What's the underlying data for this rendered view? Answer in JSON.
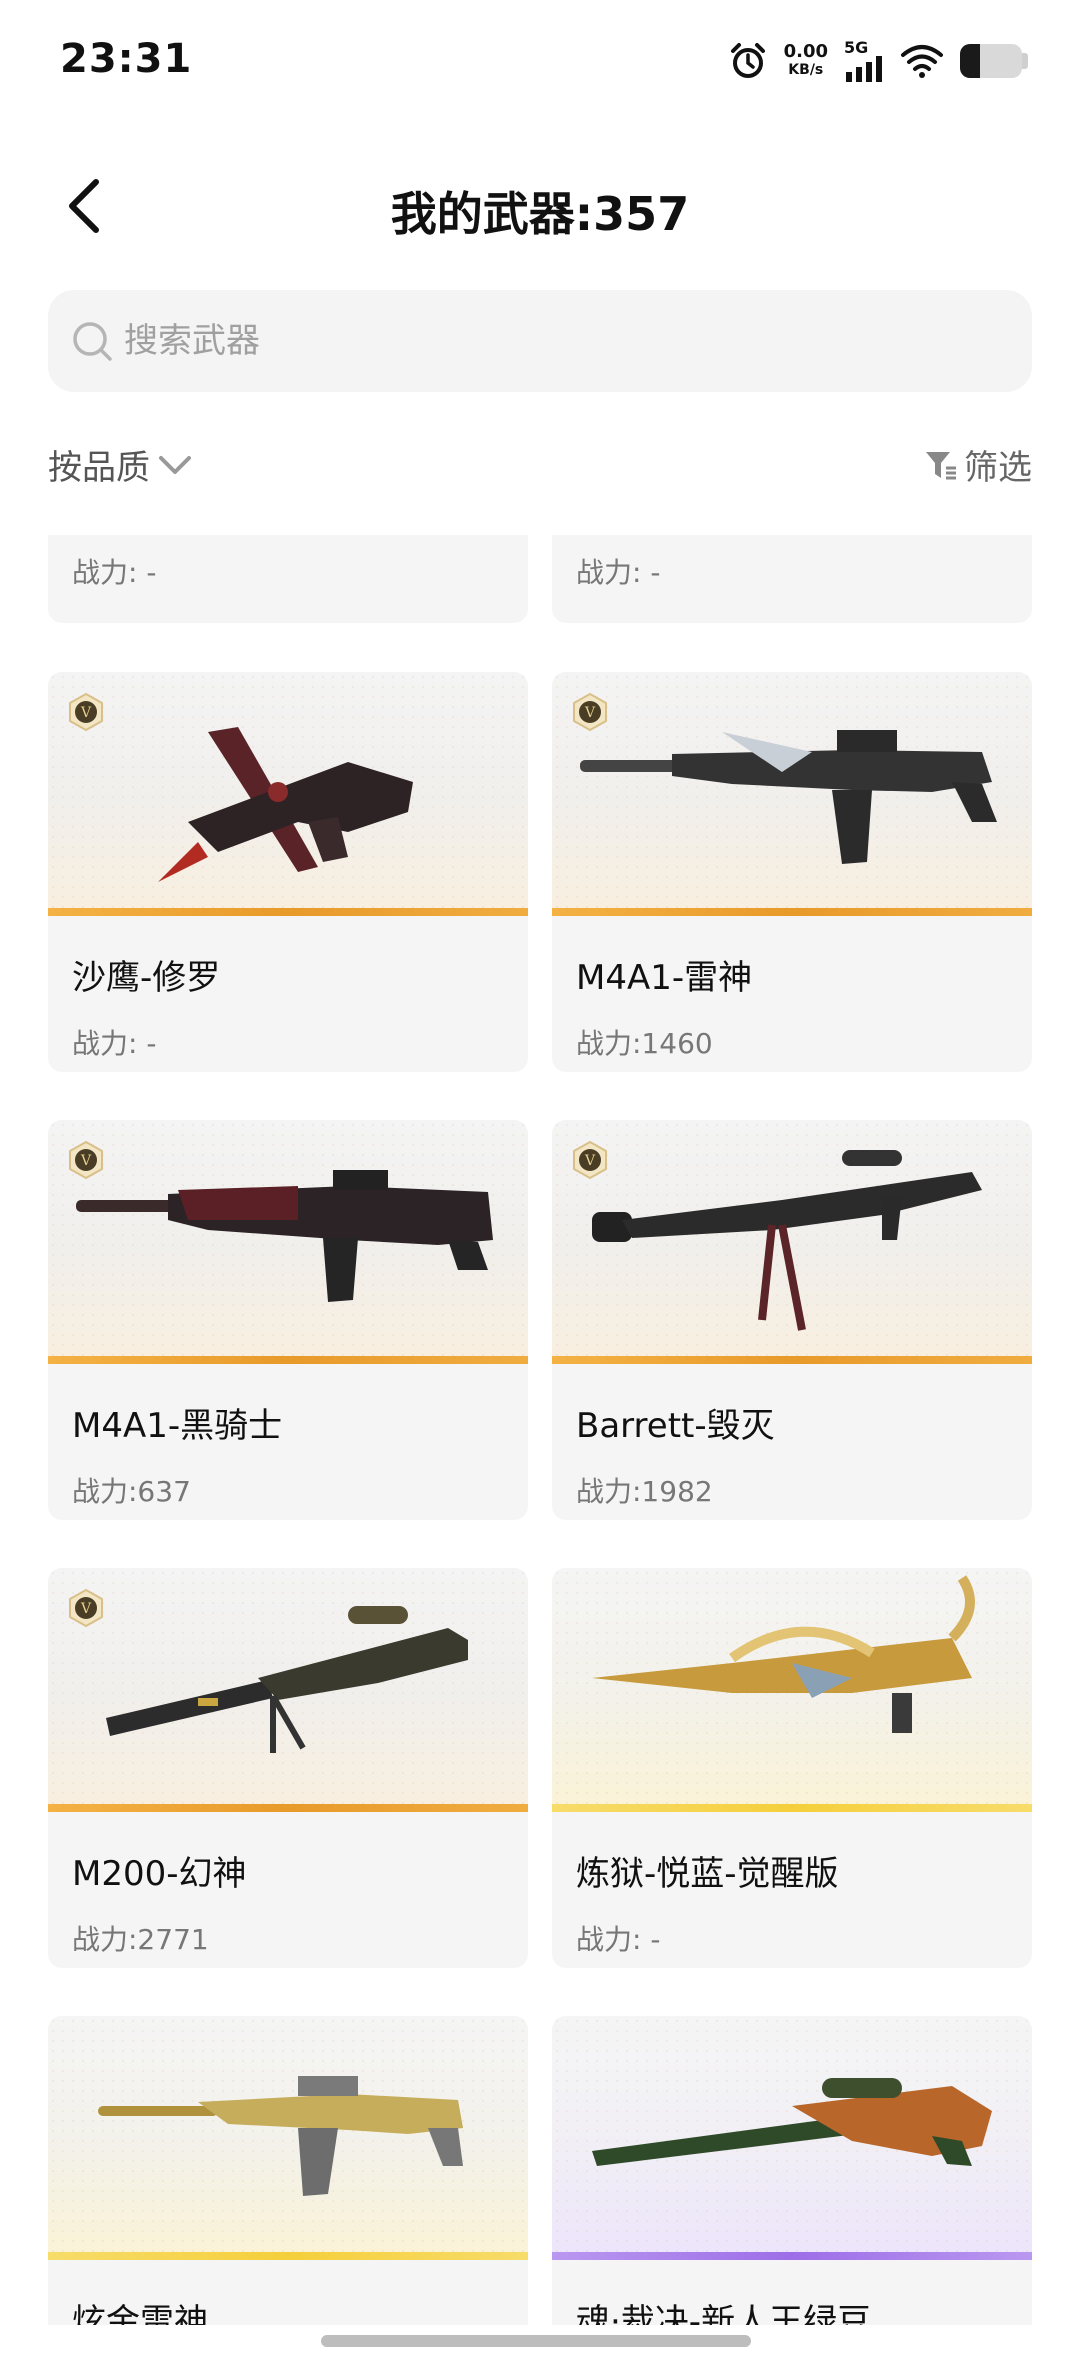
{
  "status_bar": {
    "time": "23:31",
    "net_speed_value": "0.00",
    "net_speed_unit": "KB/s",
    "network": "5G",
    "battery_level": 0.32,
    "icons": [
      "alarm-icon",
      "signal-icon",
      "wifi-icon",
      "battery-icon"
    ]
  },
  "header": {
    "title": "我的武器:357",
    "back_icon": "chevron-left-icon"
  },
  "search": {
    "placeholder": "搜索武器",
    "value": ""
  },
  "toolbar": {
    "sort_label": "按品质",
    "filter_label": "筛选"
  },
  "weapons": [
    {
      "name": "",
      "power": "战力: -"
    },
    {
      "name": "",
      "power": "战力: -"
    },
    {
      "name": "沙鹰-修罗",
      "power": "战力: -",
      "badge": "V"
    },
    {
      "name": "M4A1-雷神",
      "power": "战力:1460",
      "badge": "V"
    },
    {
      "name": "M4A1-黑骑士",
      "power": "战力:637",
      "badge": "V"
    },
    {
      "name": "Barrett-毁灭",
      "power": "战力:1982",
      "badge": "V"
    },
    {
      "name": "M200-幻神",
      "power": "战力:2771",
      "badge": "V"
    },
    {
      "name": "炼狱-悦蓝-觉醒版",
      "power": "战力: -"
    },
    {
      "name": "炫金雷神",
      "power": ""
    },
    {
      "name": "魂·裁决-新人王绿豆",
      "power": ""
    }
  ],
  "colors": {
    "accent_orange": "#e89a2a",
    "accent_yellow": "#f5cf3b",
    "accent_purple": "#9d6ee8",
    "card_bg": "#f5f5f5"
  }
}
